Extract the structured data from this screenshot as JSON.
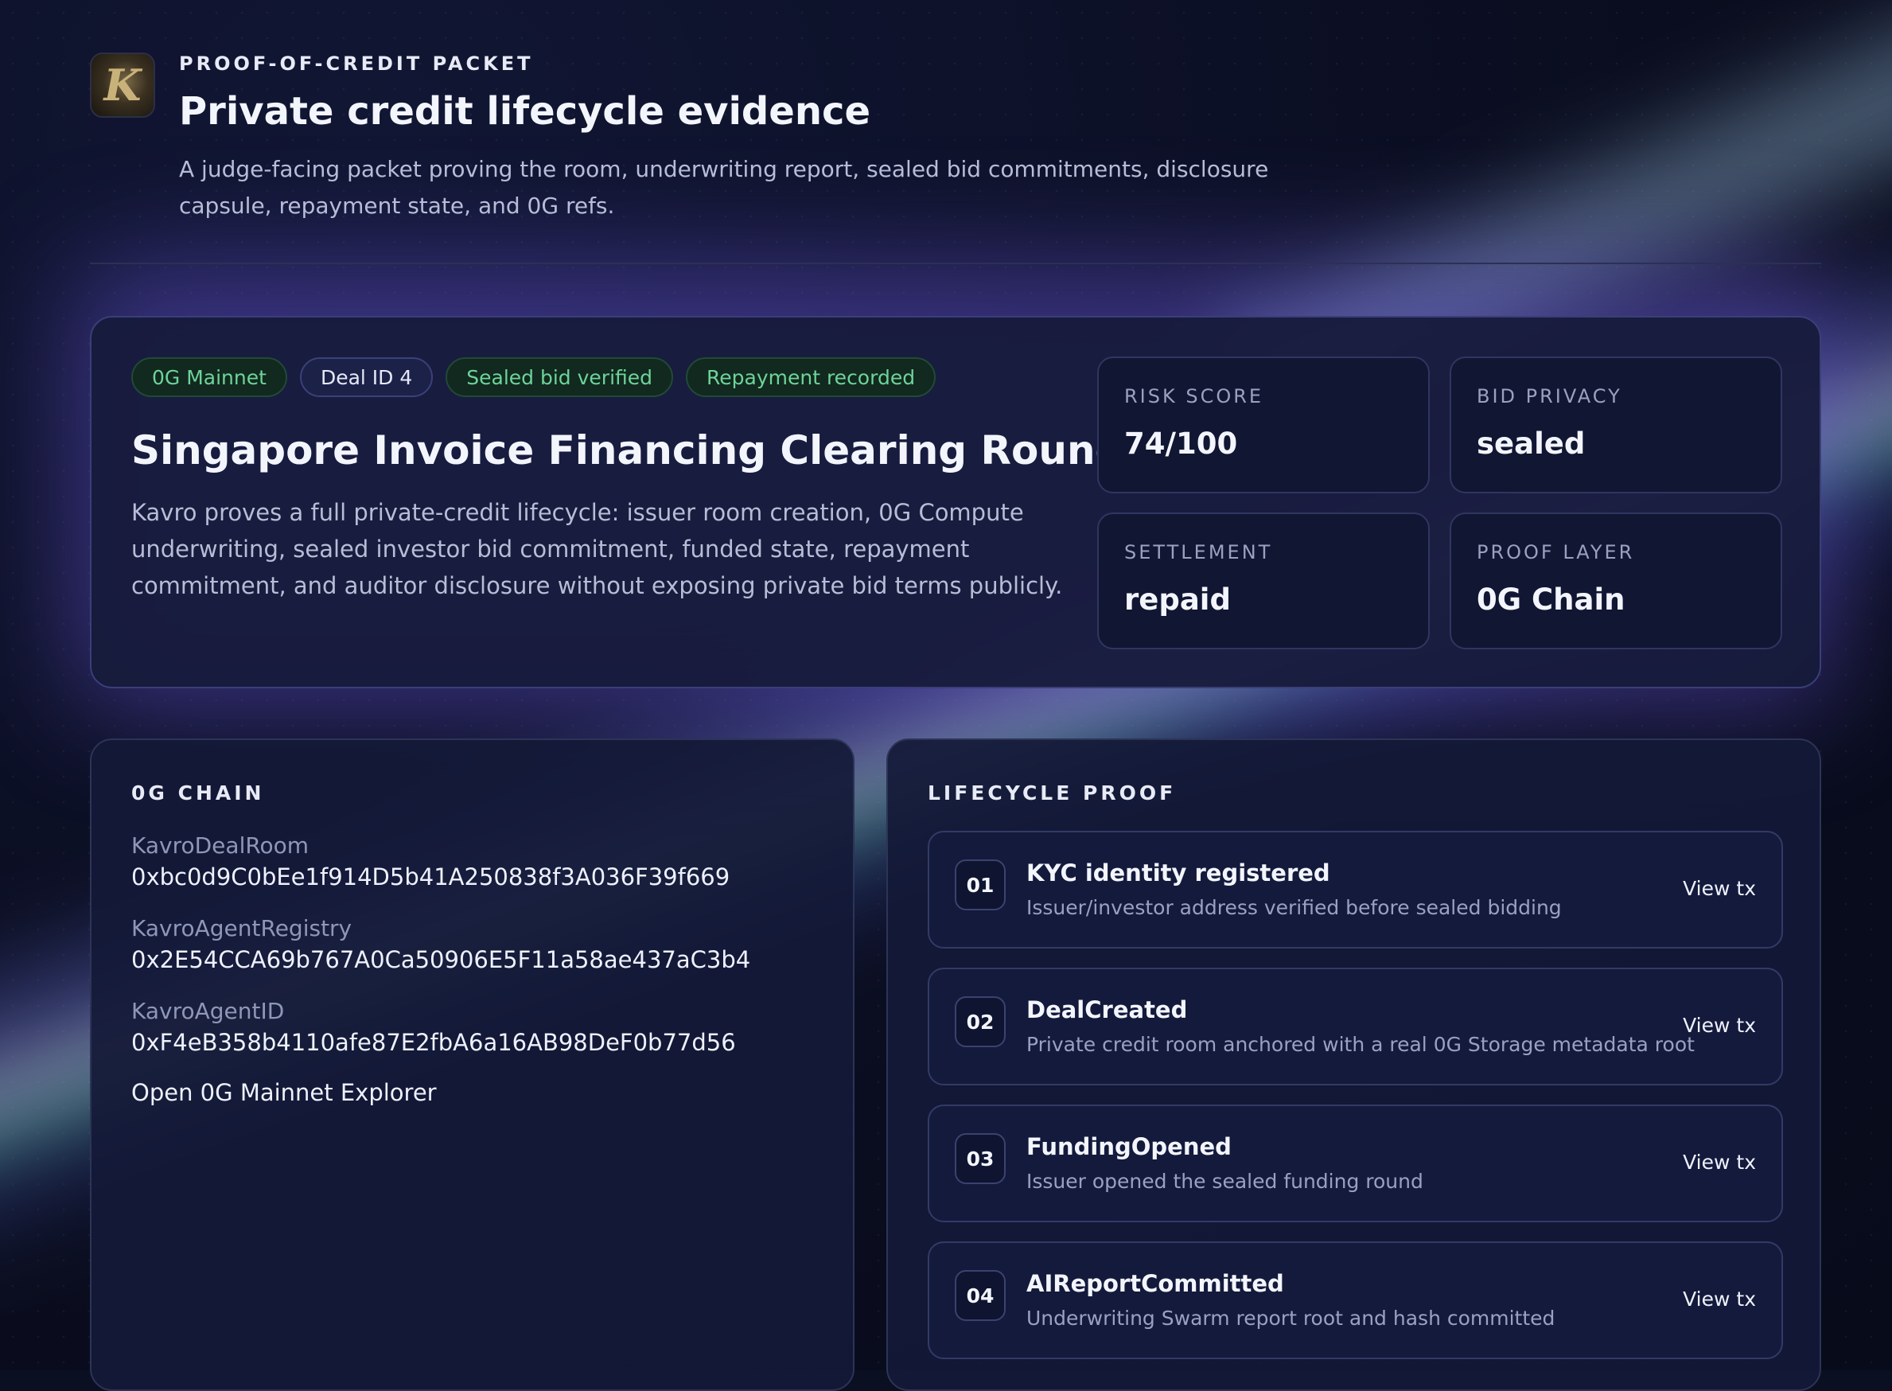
{
  "header": {
    "logo_letter": "K",
    "eyebrow": "PROOF-OF-CREDIT PACKET",
    "title": "Private credit lifecycle evidence",
    "subtitle": "A judge-facing packet proving the room, underwriting report, sealed bid commitments, disclosure capsule, repayment state, and 0G refs."
  },
  "hero": {
    "pills": [
      {
        "label": "0G Mainnet",
        "tone": "green"
      },
      {
        "label": "Deal ID 4",
        "tone": "neutral"
      },
      {
        "label": "Sealed bid verified",
        "tone": "green"
      },
      {
        "label": "Repayment recorded",
        "tone": "green"
      }
    ],
    "title": "Singapore Invoice Financing Clearing Round",
    "description": "Kavro proves a full private-credit lifecycle: issuer room creation, 0G Compute underwriting, sealed investor bid commitment, funded state, repayment commitment, and auditor disclosure without exposing private bid terms publicly.",
    "stats": [
      {
        "label": "RISK SCORE",
        "value": "74/100"
      },
      {
        "label": "BID PRIVACY",
        "value": "sealed"
      },
      {
        "label": "SETTLEMENT",
        "value": "repaid"
      },
      {
        "label": "PROOF LAYER",
        "value": "0G Chain"
      }
    ]
  },
  "chain": {
    "section_label": "0G CHAIN",
    "contracts": [
      {
        "name": "KavroDealRoom",
        "address": "0xbc0d9C0bEe1f914D5b41A250838f3A036F39f669"
      },
      {
        "name": "KavroAgentRegistry",
        "address": "0x2E54CCA69b767A0Ca50906E5F11a58ae437aC3b4"
      },
      {
        "name": "KavroAgentID",
        "address": "0xF4eB358b4110afe87E2fbA6a16AB98DeF0b77d56"
      }
    ],
    "explorer_link": "Open 0G Mainnet Explorer"
  },
  "lifecycle": {
    "section_label": "LIFECYCLE PROOF",
    "steps": [
      {
        "num": "01",
        "title": "KYC identity registered",
        "desc": "Issuer/investor address verified before sealed bidding",
        "action": "View tx"
      },
      {
        "num": "02",
        "title": "DealCreated",
        "desc": "Private credit room anchored with a real 0G Storage metadata root",
        "action": "View tx"
      },
      {
        "num": "03",
        "title": "FundingOpened",
        "desc": "Issuer opened the sealed funding round",
        "action": "View tx"
      },
      {
        "num": "04",
        "title": "AIReportCommitted",
        "desc": "Underwriting Swarm report root and hash committed",
        "action": "View tx"
      }
    ]
  }
}
